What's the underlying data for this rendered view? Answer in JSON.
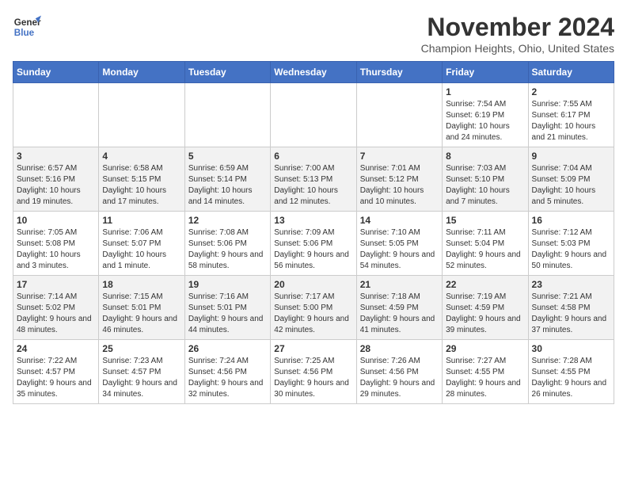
{
  "header": {
    "logo_line1": "General",
    "logo_line2": "Blue",
    "month": "November 2024",
    "location": "Champion Heights, Ohio, United States"
  },
  "weekdays": [
    "Sunday",
    "Monday",
    "Tuesday",
    "Wednesday",
    "Thursday",
    "Friday",
    "Saturday"
  ],
  "weeks": [
    [
      {
        "day": "",
        "info": ""
      },
      {
        "day": "",
        "info": ""
      },
      {
        "day": "",
        "info": ""
      },
      {
        "day": "",
        "info": ""
      },
      {
        "day": "",
        "info": ""
      },
      {
        "day": "1",
        "info": "Sunrise: 7:54 AM\nSunset: 6:19 PM\nDaylight: 10 hours and 24 minutes."
      },
      {
        "day": "2",
        "info": "Sunrise: 7:55 AM\nSunset: 6:17 PM\nDaylight: 10 hours and 21 minutes."
      }
    ],
    [
      {
        "day": "3",
        "info": "Sunrise: 6:57 AM\nSunset: 5:16 PM\nDaylight: 10 hours and 19 minutes."
      },
      {
        "day": "4",
        "info": "Sunrise: 6:58 AM\nSunset: 5:15 PM\nDaylight: 10 hours and 17 minutes."
      },
      {
        "day": "5",
        "info": "Sunrise: 6:59 AM\nSunset: 5:14 PM\nDaylight: 10 hours and 14 minutes."
      },
      {
        "day": "6",
        "info": "Sunrise: 7:00 AM\nSunset: 5:13 PM\nDaylight: 10 hours and 12 minutes."
      },
      {
        "day": "7",
        "info": "Sunrise: 7:01 AM\nSunset: 5:12 PM\nDaylight: 10 hours and 10 minutes."
      },
      {
        "day": "8",
        "info": "Sunrise: 7:03 AM\nSunset: 5:10 PM\nDaylight: 10 hours and 7 minutes."
      },
      {
        "day": "9",
        "info": "Sunrise: 7:04 AM\nSunset: 5:09 PM\nDaylight: 10 hours and 5 minutes."
      }
    ],
    [
      {
        "day": "10",
        "info": "Sunrise: 7:05 AM\nSunset: 5:08 PM\nDaylight: 10 hours and 3 minutes."
      },
      {
        "day": "11",
        "info": "Sunrise: 7:06 AM\nSunset: 5:07 PM\nDaylight: 10 hours and 1 minute."
      },
      {
        "day": "12",
        "info": "Sunrise: 7:08 AM\nSunset: 5:06 PM\nDaylight: 9 hours and 58 minutes."
      },
      {
        "day": "13",
        "info": "Sunrise: 7:09 AM\nSunset: 5:06 PM\nDaylight: 9 hours and 56 minutes."
      },
      {
        "day": "14",
        "info": "Sunrise: 7:10 AM\nSunset: 5:05 PM\nDaylight: 9 hours and 54 minutes."
      },
      {
        "day": "15",
        "info": "Sunrise: 7:11 AM\nSunset: 5:04 PM\nDaylight: 9 hours and 52 minutes."
      },
      {
        "day": "16",
        "info": "Sunrise: 7:12 AM\nSunset: 5:03 PM\nDaylight: 9 hours and 50 minutes."
      }
    ],
    [
      {
        "day": "17",
        "info": "Sunrise: 7:14 AM\nSunset: 5:02 PM\nDaylight: 9 hours and 48 minutes."
      },
      {
        "day": "18",
        "info": "Sunrise: 7:15 AM\nSunset: 5:01 PM\nDaylight: 9 hours and 46 minutes."
      },
      {
        "day": "19",
        "info": "Sunrise: 7:16 AM\nSunset: 5:01 PM\nDaylight: 9 hours and 44 minutes."
      },
      {
        "day": "20",
        "info": "Sunrise: 7:17 AM\nSunset: 5:00 PM\nDaylight: 9 hours and 42 minutes."
      },
      {
        "day": "21",
        "info": "Sunrise: 7:18 AM\nSunset: 4:59 PM\nDaylight: 9 hours and 41 minutes."
      },
      {
        "day": "22",
        "info": "Sunrise: 7:19 AM\nSunset: 4:59 PM\nDaylight: 9 hours and 39 minutes."
      },
      {
        "day": "23",
        "info": "Sunrise: 7:21 AM\nSunset: 4:58 PM\nDaylight: 9 hours and 37 minutes."
      }
    ],
    [
      {
        "day": "24",
        "info": "Sunrise: 7:22 AM\nSunset: 4:57 PM\nDaylight: 9 hours and 35 minutes."
      },
      {
        "day": "25",
        "info": "Sunrise: 7:23 AM\nSunset: 4:57 PM\nDaylight: 9 hours and 34 minutes."
      },
      {
        "day": "26",
        "info": "Sunrise: 7:24 AM\nSunset: 4:56 PM\nDaylight: 9 hours and 32 minutes."
      },
      {
        "day": "27",
        "info": "Sunrise: 7:25 AM\nSunset: 4:56 PM\nDaylight: 9 hours and 30 minutes."
      },
      {
        "day": "28",
        "info": "Sunrise: 7:26 AM\nSunset: 4:56 PM\nDaylight: 9 hours and 29 minutes."
      },
      {
        "day": "29",
        "info": "Sunrise: 7:27 AM\nSunset: 4:55 PM\nDaylight: 9 hours and 28 minutes."
      },
      {
        "day": "30",
        "info": "Sunrise: 7:28 AM\nSunset: 4:55 PM\nDaylight: 9 hours and 26 minutes."
      }
    ]
  ]
}
